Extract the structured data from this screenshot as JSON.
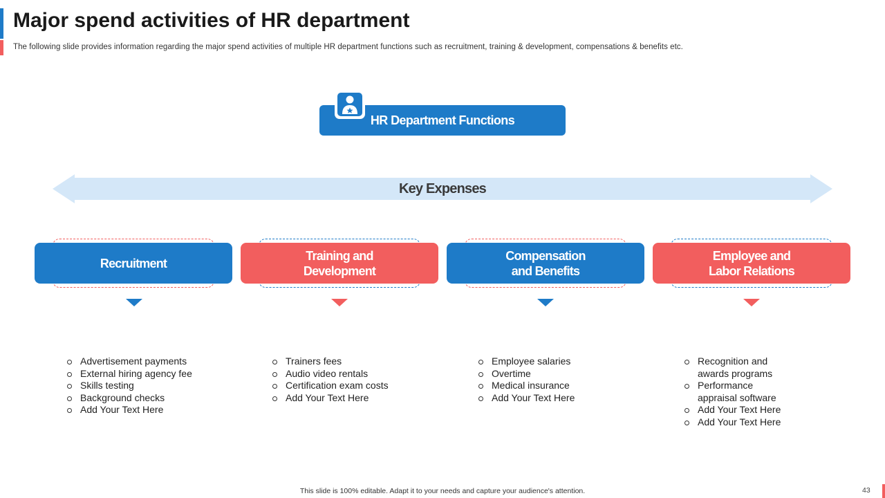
{
  "header": {
    "title": "Major spend activities of HR department",
    "subtitle": "The following slide provides information  regarding  the major spend activities  of multiple HR department  functions such as recruitment,  training  & development,  compensations  & benefits etc."
  },
  "top_node": {
    "label": "HR Department Functions",
    "icon": "user-badge-icon"
  },
  "arrow": {
    "label": "Key Expenses"
  },
  "categories": [
    {
      "label": "Recruitment",
      "color": "#1e7bc8",
      "items": [
        "Advertisement payments",
        "External hiring agency fee",
        "Skills testing",
        "Background checks",
        "Add Your Text Here"
      ]
    },
    {
      "label": "Training and Development",
      "color": "#f25e5e",
      "items": [
        "Trainers fees",
        "Audio video rentals",
        "Certification exam costs",
        "Add Your Text Here"
      ]
    },
    {
      "label": "Compensation and Benefits",
      "color": "#1e7bc8",
      "items": [
        "Employee salaries",
        "Overtime",
        "Medical insurance",
        "Add Your Text Here"
      ]
    },
    {
      "label": "Employee and Labor Relations",
      "color": "#f25e5e",
      "items": [
        "Recognition and awards  programs",
        "Performance appraisal software",
        "Add Your Text Here",
        "Add Your Text Here"
      ]
    }
  ],
  "footer": {
    "note": "This slide is 100% editable.  Adapt it to your needs and capture your audience's attention.",
    "page_number": "43"
  },
  "colors": {
    "blue": "#1e7bc8",
    "red": "#f25e5e",
    "arrow": "#d4e7f8"
  }
}
